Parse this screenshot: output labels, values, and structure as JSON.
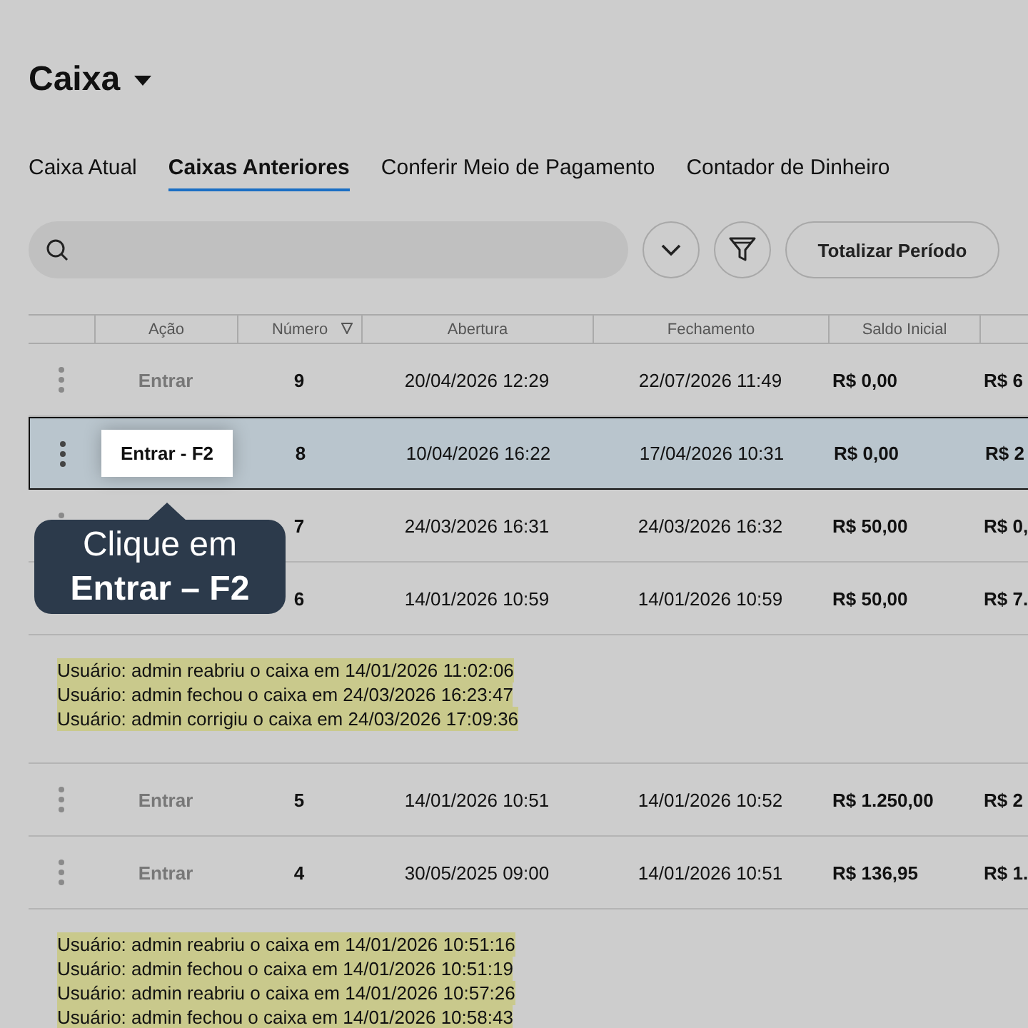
{
  "title": "Caixa",
  "tabs": [
    {
      "label": "Caixa Atual",
      "selected": false
    },
    {
      "label": "Caixas Anteriores",
      "selected": true
    },
    {
      "label": "Conferir Meio de Pagamento",
      "selected": false
    },
    {
      "label": "Contador de Dinheiro",
      "selected": false
    }
  ],
  "toolbar": {
    "total_button": "Totalizar Período"
  },
  "table": {
    "columns": [
      "Ação",
      "Número",
      "Abertura",
      "Fechamento",
      "Saldo Inicial"
    ],
    "rows": [
      {
        "kind": "row",
        "selected": false,
        "action": "Entrar",
        "number": "9",
        "opened": "20/04/2026 12:29",
        "closed": "22/07/2026 11:49",
        "initial": "R$ 0,00",
        "column_7": "R$ 6"
      },
      {
        "kind": "row",
        "selected": true,
        "action": "Entrar - F2",
        "number": "8",
        "opened": "10/04/2026 16:22",
        "closed": "17/04/2026 10:31",
        "initial": "R$ 0,00",
        "column_7": "R$ 2"
      },
      {
        "kind": "row",
        "selected": false,
        "number": "7",
        "opened": "24/03/2026 16:31",
        "closed": "24/03/2026 16:32",
        "initial": "R$ 50,00",
        "column_7": "R$ 0,"
      },
      {
        "kind": "row",
        "selected": false,
        "number": "6",
        "opened": "14/01/2026 10:59",
        "closed": "14/01/2026 10:59",
        "initial": "R$ 50,00",
        "column_7": "R$ 7."
      },
      {
        "kind": "log",
        "lines": [
          "Usuário: admin reabriu o caixa em 14/01/2026 11:02:06",
          "Usuário: admin fechou o caixa em 24/03/2026 16:23:47",
          "Usuário: admin corrigiu o caixa em 24/03/2026 17:09:36"
        ]
      },
      {
        "kind": "row",
        "selected": false,
        "action": "Entrar",
        "number": "5",
        "opened": "14/01/2026 10:51",
        "closed": "14/01/2026 10:52",
        "initial": "R$ 1.250,00",
        "column_7": "R$ 2"
      },
      {
        "kind": "row",
        "selected": false,
        "action": "Entrar",
        "number": "4",
        "opened": "30/05/2025 09:00",
        "closed": "14/01/2026 10:51",
        "initial": "R$ 136,95",
        "column_7": "R$ 1."
      },
      {
        "kind": "log",
        "lines": [
          "Usuário: admin reabriu o caixa em 14/01/2026 10:51:16",
          "Usuário: admin fechou o caixa em 14/01/2026 10:51:19",
          "Usuário: admin reabriu o caixa em 14/01/2026 10:57:26",
          "Usuário: admin fechou o caixa em 14/01/2026 10:58:43"
        ]
      }
    ]
  },
  "tooltip": "Clique em\n**Entrar – F2**"
}
